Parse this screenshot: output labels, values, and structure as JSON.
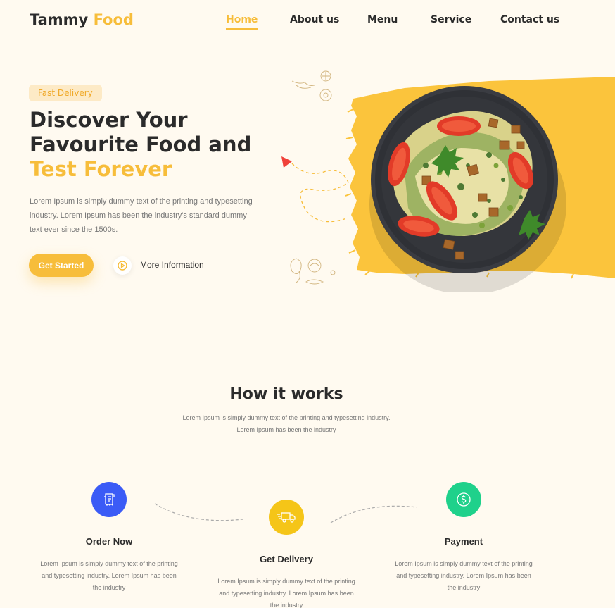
{
  "brand": {
    "name_part1": "Tammy",
    "name_part2": "Food",
    "accent_color": "#f7bd3a"
  },
  "nav": {
    "items": [
      {
        "label": "Home",
        "active": true
      },
      {
        "label": "About us",
        "active": false
      },
      {
        "label": "Menu",
        "active": false
      },
      {
        "label": "Service",
        "active": false
      },
      {
        "label": "Contact us",
        "active": false
      }
    ]
  },
  "hero": {
    "badge": "Fast Delivery",
    "title_line1": "Discover Your",
    "title_line2": "Favourite Food and",
    "title_line3": "Test Forever",
    "description": "Lorem Ipsum is simply dummy text of the printing and typesetting industry. Lorem Ipsum has been the industry's standard dummy text ever since the 1500s.",
    "cta_label": "Get Started",
    "more_label": "More Information",
    "play_icon": "play-circle-icon",
    "image": "salad-plate-photo"
  },
  "how": {
    "title": "How it works",
    "subtitle": "Lorem Ipsum is simply dummy text of the printing and typesetting industry. Lorem Ipsum has been the industry",
    "steps": [
      {
        "title": "Order Now",
        "icon": "receipt-icon",
        "color": "#3b5bf6",
        "desc": "Lorem Ipsum is simply dummy text of the printing and typesetting industry. Lorem Ipsum has been the industry"
      },
      {
        "title": "Get Delivery",
        "icon": "delivery-truck-icon",
        "color": "#f5c518",
        "desc": "Lorem Ipsum is simply dummy text of the printing and typesetting industry. Lorem Ipsum has been the industry"
      },
      {
        "title": "Payment",
        "icon": "dollar-coin-icon",
        "color": "#1fd18b",
        "desc": "Lorem Ipsum is simply dummy text of the printing and typesetting industry. Lorem Ipsum has been the industry"
      }
    ]
  }
}
